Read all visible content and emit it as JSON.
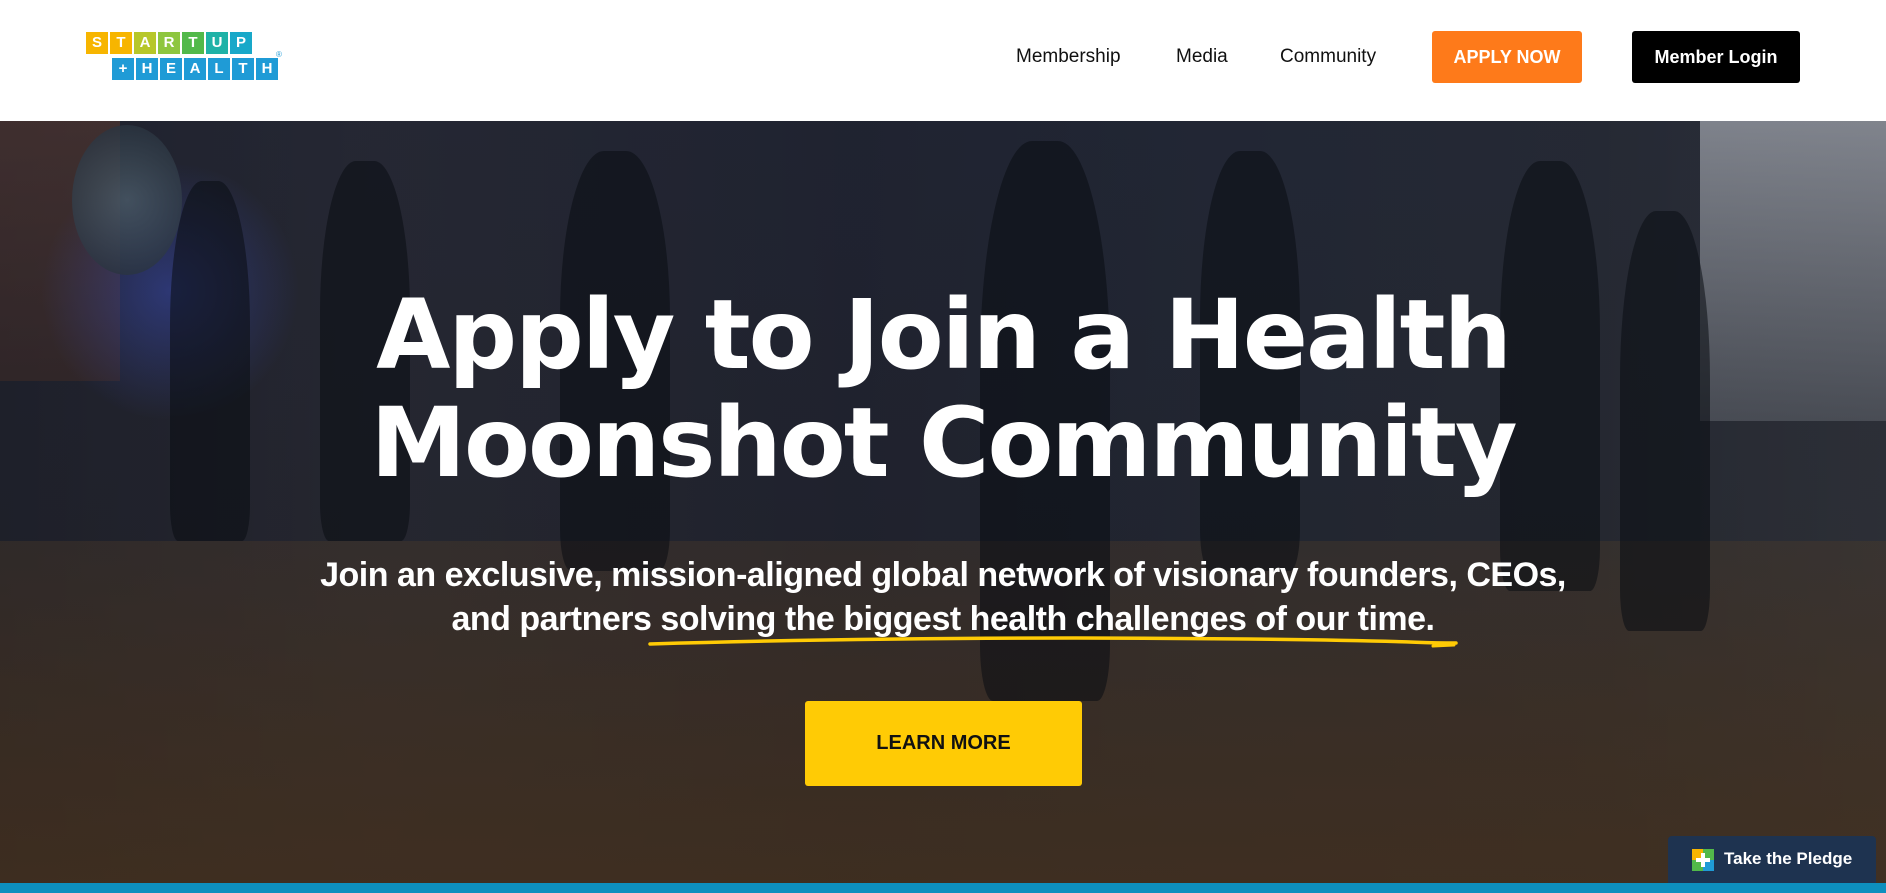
{
  "header": {
    "logo": {
      "top_letters": [
        "S",
        "T",
        "A",
        "R",
        "T",
        "U",
        "P"
      ],
      "bottom_letters": [
        "+",
        "H",
        "E",
        "A",
        "L",
        "T",
        "H"
      ],
      "top_colors": [
        "#f7b500",
        "#f7b500",
        "#b7c72a",
        "#8ec63f",
        "#52b94a",
        "#1fb2a7",
        "#18a8c9"
      ],
      "bottom_colors": [
        "#1f9bd6",
        "#1f9bd6",
        "#1f9bd6",
        "#1f9bd6",
        "#1f9bd6",
        "#1f9bd6",
        "#1f9bd6"
      ],
      "registered_mark": "®"
    },
    "nav": {
      "membership": "Membership",
      "media": "Media",
      "community": "Community",
      "apply_now": "APPLY NOW",
      "member_login": "Member Login"
    },
    "colors": {
      "apply_button": "#fe7a1a",
      "login_button": "#000000"
    }
  },
  "hero": {
    "title_line1": "Apply to Join a Health",
    "title_line2": "Moonshot Community",
    "subtitle_line1": "Join an exclusive, mission-aligned global network of visionary founders, CEOs,",
    "subtitle_line2": "and partners solving the biggest health challenges of our time.",
    "learn_more": "LEARN MORE",
    "underline_color": "#ffcb05",
    "button_color": "#ffcb05"
  },
  "pledge_widget": {
    "label": "Take the Pledge",
    "icon": "plus-square-icon"
  }
}
